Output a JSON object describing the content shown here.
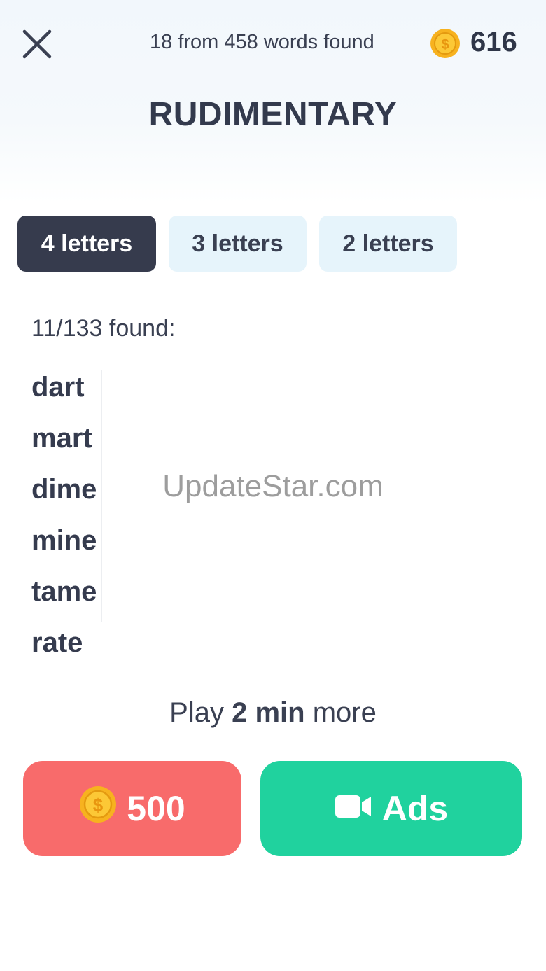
{
  "header": {
    "progress_found": "18",
    "progress_total": "458",
    "progress_text": "18 from 458 words found",
    "coins": "616"
  },
  "puzzle": {
    "word": "RUDIMENTARY"
  },
  "tabs": [
    {
      "label": "4 letters",
      "active": true
    },
    {
      "label": "3 letters",
      "active": false
    },
    {
      "label": "2 letters",
      "active": false
    }
  ],
  "found": {
    "label": "11/133 found:",
    "words": [
      "dart",
      "mart",
      "dime",
      "mine",
      "tame",
      "rate"
    ]
  },
  "watermark": "UpdateStar.com",
  "play_more": {
    "prefix": "Play ",
    "duration": "2 min",
    "suffix": " more"
  },
  "actions": {
    "coins_button_label": "500",
    "ads_button_label": "Ads"
  },
  "colors": {
    "active_tab": "#363b4d",
    "inactive_tab": "#e6f4fb",
    "coin_button": "#f86b6b",
    "ads_button": "#20d29e",
    "coin": "#f7b21f"
  },
  "icons": [
    "close-icon",
    "coin-icon",
    "video-camera-icon"
  ]
}
